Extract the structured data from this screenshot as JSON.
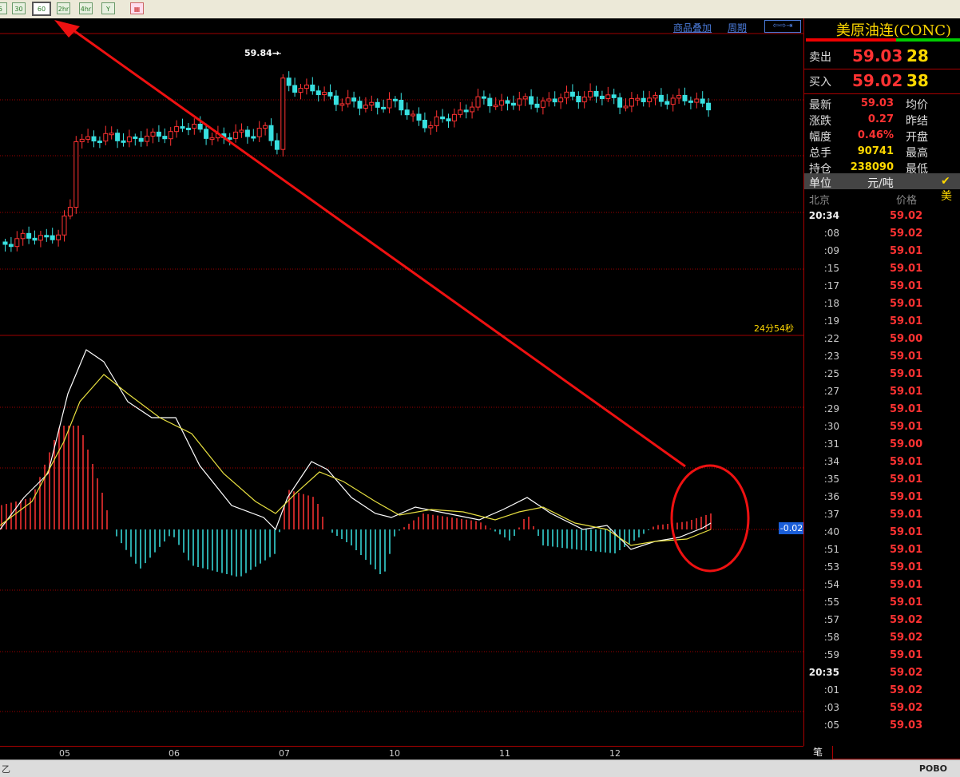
{
  "toolbar": {
    "buttons": [
      {
        "label": "5"
      },
      {
        "label": "30"
      },
      {
        "label": "60",
        "active": true
      },
      {
        "label": "2hr"
      },
      {
        "label": "4hr"
      },
      {
        "label": "Y"
      },
      {
        "label": "▦"
      }
    ]
  },
  "chart": {
    "overlay_label": "商品叠加",
    "period_label": "周期",
    "high_label": "59.84→",
    "countdown": "24分54秒",
    "macd_value": "-0.02",
    "x_labels": [
      "05",
      "06",
      "07",
      "10",
      "11",
      "12"
    ]
  },
  "quote": {
    "title": "美原油连(CONC)",
    "ask_label": "卖出",
    "ask_price": "59.03",
    "ask_vol": "28",
    "bid_label": "买入",
    "bid_price": "59.02",
    "bid_vol": "38",
    "stats": [
      {
        "label": "最新",
        "value": "59.03",
        "color": "#ff3232",
        "label2": "均价"
      },
      {
        "label": "涨跌",
        "value": "0.27",
        "color": "#ff3232",
        "label2": "昨结"
      },
      {
        "label": "幅度",
        "value": "0.46%",
        "color": "#ff3232",
        "label2": "开盘"
      },
      {
        "label": "总手",
        "value": "90741",
        "color": "#ffd800",
        "label2": "最高"
      },
      {
        "label": "持仓",
        "value": "238090",
        "color": "#ffd800",
        "label2": "最低"
      }
    ],
    "unit_label": "单位",
    "unit_value": "元/吨",
    "check_label": "✔ 美",
    "col_time": "北京",
    "col_price": "价格",
    "ticks": [
      {
        "t": "20:34",
        "p": "59.02",
        "full": true
      },
      {
        "t": ":08",
        "p": "59.02"
      },
      {
        "t": ":09",
        "p": "59.01"
      },
      {
        "t": ":15",
        "p": "59.01"
      },
      {
        "t": ":17",
        "p": "59.01"
      },
      {
        "t": ":18",
        "p": "59.01"
      },
      {
        "t": ":19",
        "p": "59.01"
      },
      {
        "t": ":22",
        "p": "59.00"
      },
      {
        "t": ":23",
        "p": "59.01"
      },
      {
        "t": ":25",
        "p": "59.01"
      },
      {
        "t": ":27",
        "p": "59.01"
      },
      {
        "t": ":29",
        "p": "59.01"
      },
      {
        "t": ":30",
        "p": "59.01"
      },
      {
        "t": ":31",
        "p": "59.00"
      },
      {
        "t": ":34",
        "p": "59.01"
      },
      {
        "t": ":35",
        "p": "59.01"
      },
      {
        "t": ":36",
        "p": "59.01"
      },
      {
        "t": ":37",
        "p": "59.01"
      },
      {
        "t": ":40",
        "p": "59.01"
      },
      {
        "t": ":51",
        "p": "59.01"
      },
      {
        "t": ":53",
        "p": "59.01"
      },
      {
        "t": ":54",
        "p": "59.01"
      },
      {
        "t": ":55",
        "p": "59.01"
      },
      {
        "t": ":57",
        "p": "59.02"
      },
      {
        "t": ":58",
        "p": "59.02"
      },
      {
        "t": ":59",
        "p": "59.01"
      },
      {
        "t": "20:35",
        "p": "59.02",
        "full": true
      },
      {
        "t": ":01",
        "p": "59.02"
      },
      {
        "t": ":03",
        "p": "59.02"
      },
      {
        "t": ":05",
        "p": "59.03"
      }
    ],
    "tab_label": "笔"
  },
  "status": {
    "left_text": "乙",
    "logo": "POBO"
  },
  "colors": {
    "up": "#ff3232",
    "down": "#38e0e0",
    "grid": "#a00000",
    "annotation": "#ee1111",
    "dif": "#ffffff",
    "dea": "#e8e040"
  }
}
